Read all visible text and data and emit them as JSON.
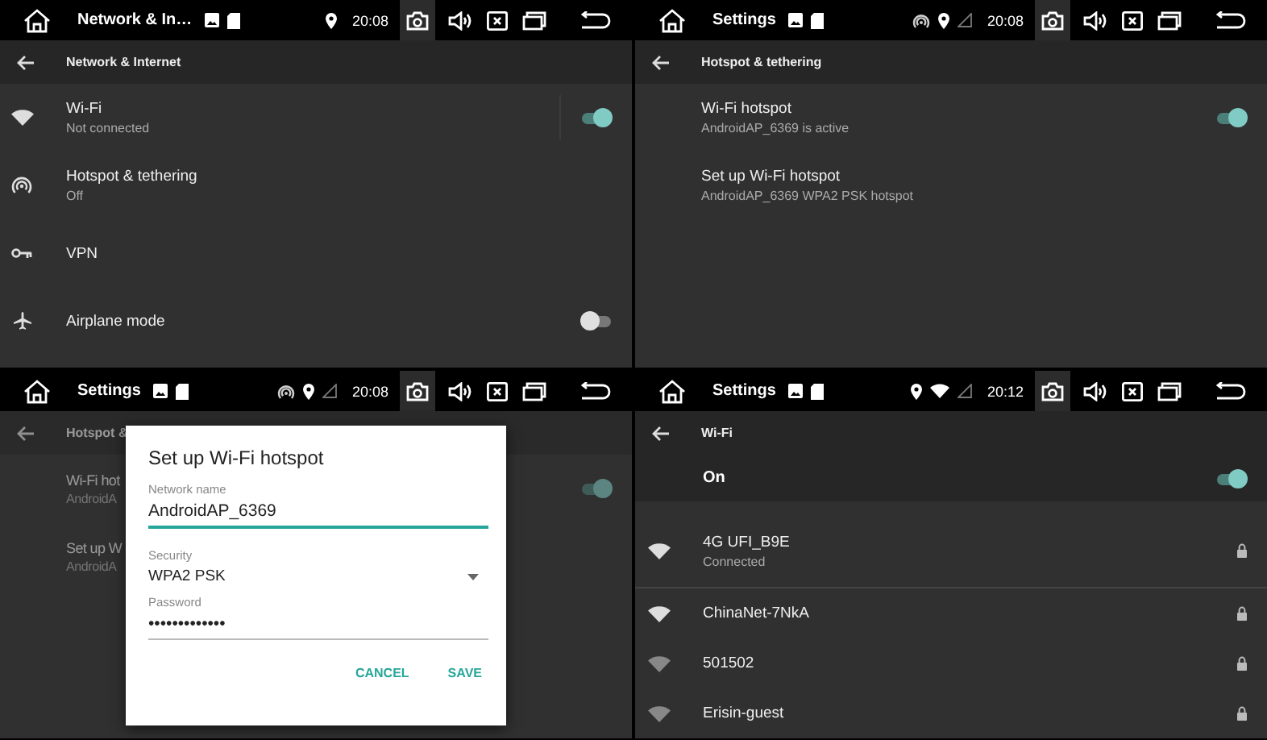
{
  "panels": [
    {
      "status_bar": {
        "title": "Network & In…",
        "icons": [
          {
            "kind": "location"
          }
        ],
        "time": "20:08"
      },
      "toolbar": {
        "title": "Network & Internet"
      },
      "items": [
        {
          "kind": "wifi",
          "title": "Wi-Fi",
          "subtitle": "Not connected",
          "on": true
        },
        {
          "kind": "hotspot",
          "title": "Hotspot & tethering",
          "subtitle": "Off"
        },
        {
          "kind": "key",
          "title": "VPN"
        },
        {
          "kind": "airplane",
          "title": "Airplane mode",
          "on": false
        }
      ]
    },
    {
      "status_bar": {
        "title": "Settings",
        "icons": [
          {
            "kind": "hotspot"
          },
          {
            "kind": "location"
          },
          {
            "kind": "cell-signal"
          }
        ],
        "time": "20:08"
      },
      "toolbar": {
        "title": "Hotspot & tethering"
      },
      "items": [
        {
          "title": "Wi-Fi hotspot",
          "subtitle": "AndroidAP_6369 is active",
          "on": true
        },
        {
          "title": "Set up Wi-Fi hotspot",
          "subtitle": "AndroidAP_6369 WPA2 PSK hotspot"
        }
      ]
    },
    {
      "status_bar": {
        "title": "Settings",
        "icons": [
          {
            "kind": "hotspot"
          },
          {
            "kind": "location"
          },
          {
            "kind": "cell-signal"
          }
        ],
        "time": "20:08"
      },
      "dimmed": true,
      "toolbar": {
        "title": "Hotspot &"
      },
      "items": [
        {
          "title": "Wi-Fi hot",
          "subtitle": "AndroidA",
          "on": true
        },
        {
          "title": "Set up W",
          "subtitle": "AndroidA"
        }
      ],
      "dialog": {
        "title": "Set up Wi-Fi hotspot",
        "fields": [
          {
            "kind": "text",
            "label": "Network name",
            "value": "AndroidAP_6369",
            "focused": true
          },
          {
            "kind": "dropdown",
            "label": "Security",
            "value": "WPA2 PSK"
          },
          {
            "kind": "text",
            "label": "Password",
            "value": "•••••••••••••",
            "focused": false
          }
        ],
        "buttons": [
          "CANCEL",
          "SAVE"
        ]
      }
    },
    {
      "status_bar": {
        "title": "Settings",
        "icons": [
          {
            "kind": "location"
          },
          {
            "kind": "wifi"
          },
          {
            "kind": "cell-signal"
          }
        ],
        "time": "20:12"
      },
      "toolbar": {
        "title": "Wi-Fi"
      },
      "master_switch": {
        "label": "On",
        "on": true
      },
      "networks": [
        {
          "name": "4G UFI_B9E",
          "status": "Connected",
          "kind": "strong",
          "locked": true
        },
        {
          "name": "ChinaNet-7NkA",
          "kind": "strong",
          "locked": true
        },
        {
          "name": "501502",
          "kind": "weak",
          "locked": true
        },
        {
          "name": "Erisin-guest",
          "kind": "weak",
          "locked": true
        }
      ]
    }
  ]
}
